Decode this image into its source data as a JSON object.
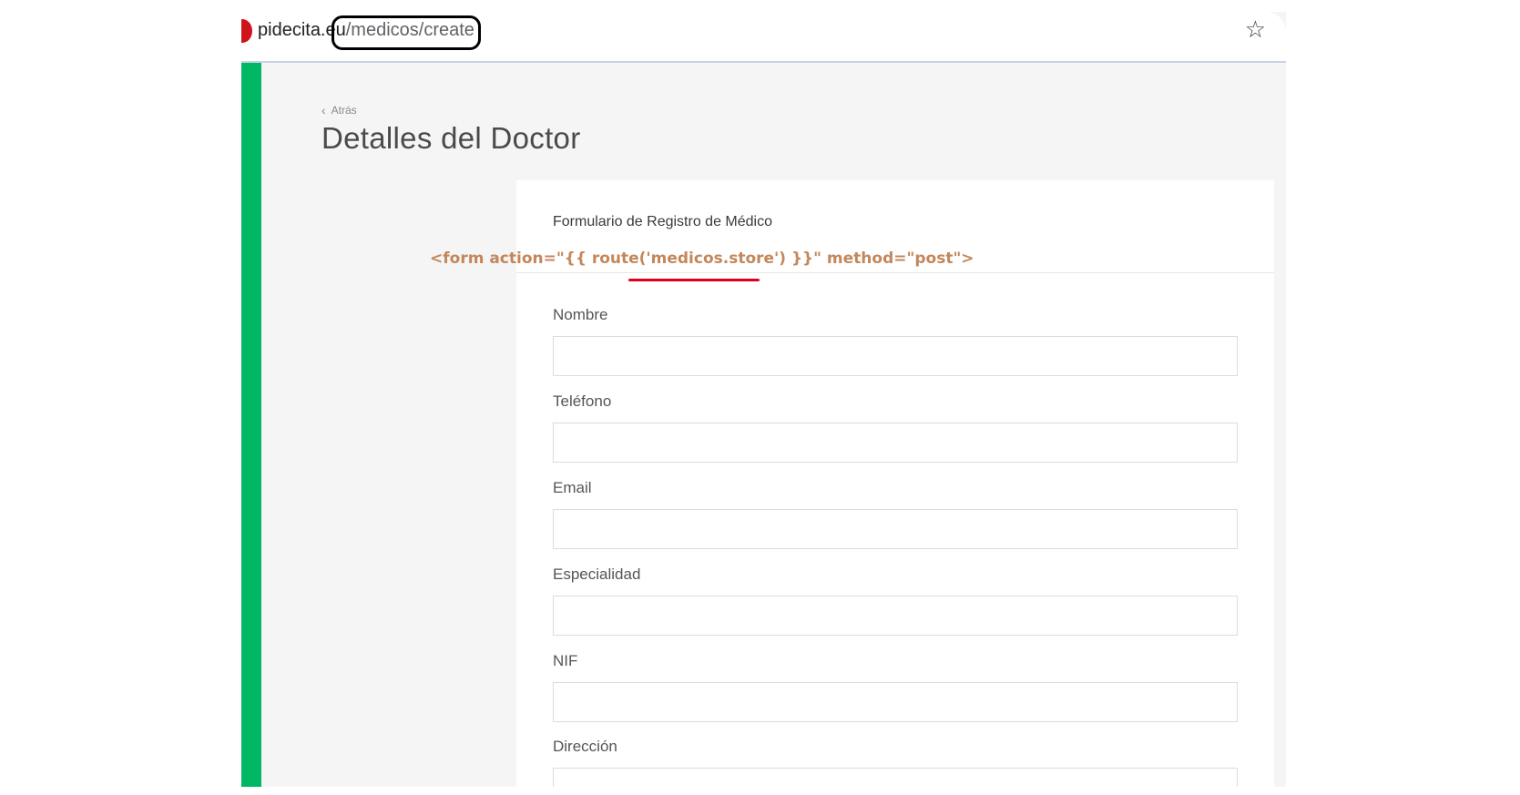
{
  "browser": {
    "url_host": "pidecita.eu",
    "url_path": "/medicos/create"
  },
  "colors": {
    "sidebar": "#00b863",
    "favicon": "#d0131a",
    "annotation_text": "#c3875b",
    "annotation_underline": "#e0001b"
  },
  "icons": {
    "bookmark": "star-icon",
    "back": "chevron-left-icon"
  },
  "page": {
    "back_label": "Atrás",
    "title": "Detalles del Doctor"
  },
  "card": {
    "title": "Formulario de Registro de Médico"
  },
  "form": {
    "fields": [
      {
        "label": "Nombre",
        "value": ""
      },
      {
        "label": "Teléfono",
        "value": ""
      },
      {
        "label": "Email",
        "value": ""
      },
      {
        "label": "Especialidad",
        "value": ""
      },
      {
        "label": "NIF",
        "value": ""
      },
      {
        "label": "Dirección",
        "value": ""
      }
    ]
  },
  "annotation": {
    "code": "<form action=\"{{ route('medicos.store') }}\" method=\"post\">"
  }
}
